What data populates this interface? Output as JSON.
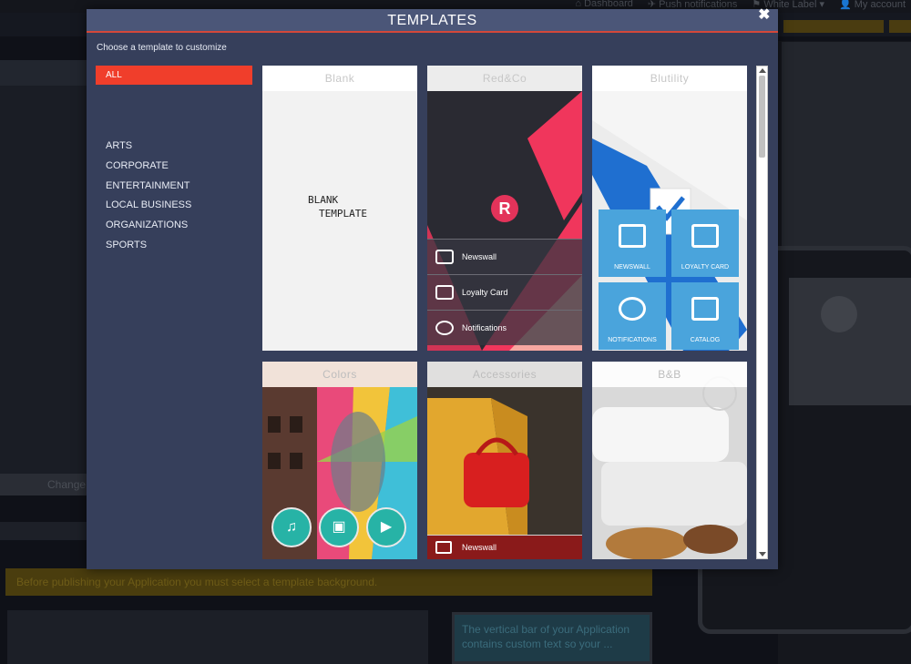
{
  "background": {
    "nav": [
      {
        "label": "Dashboard"
      },
      {
        "label": "Push notifications"
      },
      {
        "label": "White Label"
      },
      {
        "label": "My account"
      }
    ],
    "change_button": "Change",
    "warning_text": "Before publishing your Application you must select a template background.",
    "note_text": "The vertical bar of your Application contains custom text so your ...",
    "colors": {
      "warning_bg": "#4a3d0e",
      "note_bg": "#1e3b47"
    }
  },
  "modal": {
    "title": "TEMPLATES",
    "close_icon": "close-icon",
    "subtitle": "Choose a template to customize",
    "categories": {
      "selected": "ALL",
      "items": [
        "ARTS",
        "CORPORATE",
        "ENTERTAINMENT",
        "LOCAL BUSINESS",
        "ORGANIZATIONS",
        "SPORTS"
      ]
    },
    "templates": [
      {
        "name": "Blank",
        "body_lines": [
          "BLANK",
          "TEMPLATE"
        ]
      },
      {
        "name": "Red&Co",
        "logo_letter": "R",
        "menu": [
          "Newswall",
          "Loyalty Card",
          "Notifications"
        ]
      },
      {
        "name": "Blutility",
        "tiles": [
          "NEWSWALL",
          "LOYALTY CARD",
          "NOTIFICATIONS",
          "CATALOG"
        ]
      },
      {
        "name": "Colors",
        "buttons": [
          "music-icon",
          "image-icon",
          "play-icon"
        ]
      },
      {
        "name": "Accessories",
        "menu": [
          "Newswall"
        ]
      },
      {
        "name": "B&B"
      }
    ],
    "colors": {
      "header_bg": "#4b5678",
      "modal_bg": "#363f5b",
      "accent_red": "#f03e2b",
      "tile_blue": "#4aa4dc",
      "teal": "#27b3a6"
    }
  }
}
